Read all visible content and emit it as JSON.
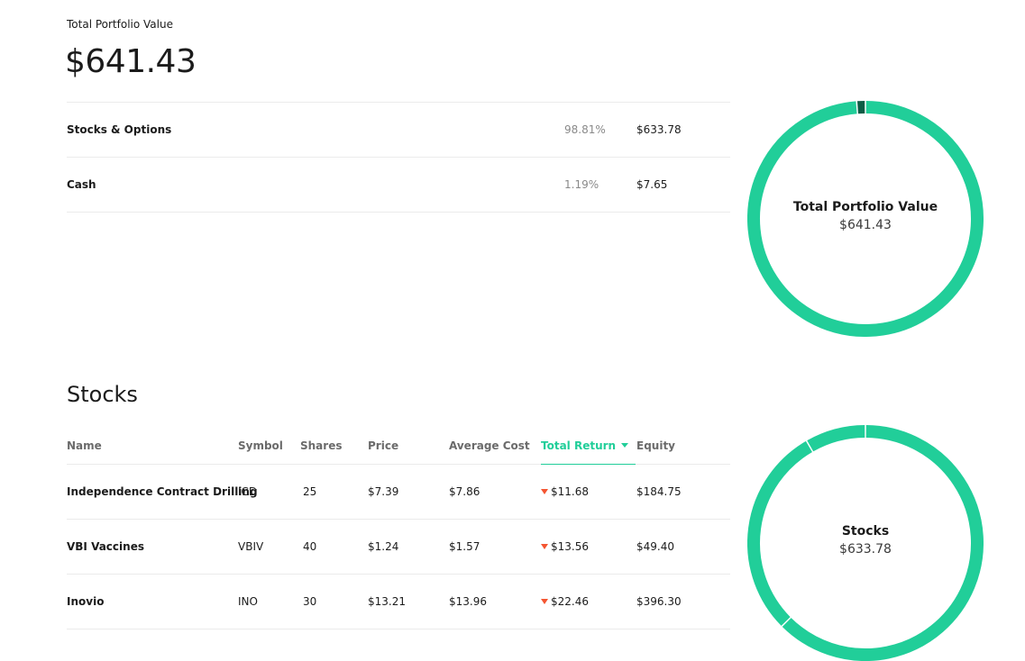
{
  "summary": {
    "label": "Total Portfolio Value",
    "value": "$641.43",
    "rows": [
      {
        "name": "Stocks & Options",
        "percent": "98.81%",
        "amount": "$633.78"
      },
      {
        "name": "Cash",
        "percent": "1.19%",
        "amount": "$7.65"
      }
    ]
  },
  "portfolio_donut": {
    "title": "Total Portfolio Value",
    "value": "$641.43",
    "segments": [
      {
        "share": 0.9881,
        "color": "#21ce99"
      },
      {
        "share": 0.0119,
        "color": "#0d5c45"
      }
    ]
  },
  "stocks": {
    "title": "Stocks",
    "columns": {
      "name": "Name",
      "symbol": "Symbol",
      "shares": "Shares",
      "price": "Price",
      "average_cost": "Average Cost",
      "total_return": "Total Return",
      "equity": "Equity"
    },
    "rows": [
      {
        "name": "Independence Contract Drilling",
        "symbol": "ICD",
        "shares": "25",
        "price": "$7.39",
        "average_cost": "$7.86",
        "total_return": "$11.68",
        "equity": "$184.75"
      },
      {
        "name": "VBI Vaccines",
        "symbol": "VBIV",
        "shares": "40",
        "price": "$1.24",
        "average_cost": "$1.57",
        "total_return": "$13.56",
        "equity": "$49.40"
      },
      {
        "name": "Inovio",
        "symbol": "INO",
        "shares": "30",
        "price": "$13.21",
        "average_cost": "$13.96",
        "total_return": "$22.46",
        "equity": "$396.30"
      }
    ]
  },
  "stocks_donut": {
    "title": "Stocks",
    "value": "$633.78",
    "segments": [
      {
        "share": 0.6253,
        "color": "#21ce99"
      },
      {
        "share": 0.2915,
        "color": "#21ce99"
      },
      {
        "share": 0.0832,
        "color": "#21ce99"
      }
    ]
  },
  "colors": {
    "accent": "#21ce99",
    "negative": "#f45531",
    "dark_segment": "#0d5c45"
  }
}
